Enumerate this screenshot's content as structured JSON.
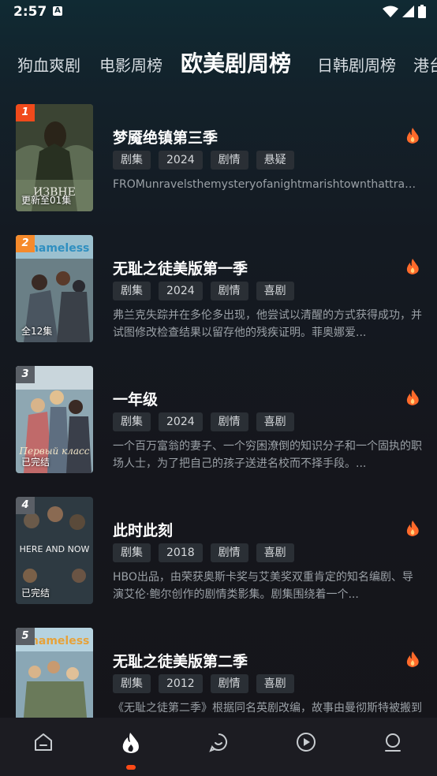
{
  "status": {
    "time": "2:57",
    "notice": "A"
  },
  "tabs": [
    {
      "label": "狗血爽剧"
    },
    {
      "label": "电影周榜"
    },
    {
      "label": "欧美剧周榜"
    },
    {
      "label": "日韩剧周榜"
    },
    {
      "label": "港台"
    }
  ],
  "items": [
    {
      "rank": "1",
      "rank_color": "#f04a1b",
      "episodes": "更新至01集",
      "title": "梦魇绝镇第三季",
      "tags": [
        "剧集",
        "2024",
        "剧情",
        "悬疑"
      ],
      "desc": "FROMunravelsthemysteryofanightmarishtownthattrapsa...",
      "poster_text": "ИЗВНЕ"
    },
    {
      "rank": "2",
      "rank_color": "#f58a2b",
      "episodes": "全12集",
      "title": "无耻之徒美版第一季",
      "tags": [
        "剧集",
        "2024",
        "剧情",
        "喜剧"
      ],
      "desc": "弗兰克失踪并在多伦多出现，他尝试以清醒的方式获得成功，并试图修改检查结果以留存他的残疾证明。菲奥娜爱...",
      "poster_text": "shameless"
    },
    {
      "rank": "3",
      "rank_color": "#5a5f66",
      "episodes": "已完结",
      "title": "一年级",
      "tags": [
        "剧集",
        "2024",
        "剧情",
        "喜剧"
      ],
      "desc": "一个百万富翁的妻子、一个穷困潦倒的知识分子和一个固执的职场人士，为了把自己的孩子送进名校而不择手段。...",
      "poster_text": "Первый класс"
    },
    {
      "rank": "4",
      "rank_color": "#5a5f66",
      "episodes": "已完结",
      "title": "此时此刻",
      "tags": [
        "剧集",
        "2018",
        "剧情",
        "喜剧"
      ],
      "desc": "HBO出品，由荣获奥斯卡奖与艾美奖双重肯定的知名编剧、导演艾伦·鲍尔创作的剧情类影集。剧集围绕着一个...",
      "poster_text": "HERE AND NOW"
    },
    {
      "rank": "5",
      "rank_color": "#5a5f66",
      "episodes": "",
      "title": "无耻之徒美版第二季",
      "tags": [
        "剧集",
        "2012",
        "剧情",
        "喜剧"
      ],
      "desc": "《无耻之徒第二季》根据同名英剧改编，故事由曼彻斯特被搬到了风城芝加哥，在经济萧条的大背景下，一个工人...",
      "poster_text": "shameless"
    }
  ],
  "nav": [
    {
      "icon": "home-icon"
    },
    {
      "icon": "fire-icon"
    },
    {
      "icon": "chat-icon"
    },
    {
      "icon": "play-icon"
    },
    {
      "icon": "profile-icon"
    }
  ],
  "colors": {
    "accent": "#ff4a17",
    "tag_bg": "#2a2f35",
    "desc": "#9aa0a6"
  }
}
